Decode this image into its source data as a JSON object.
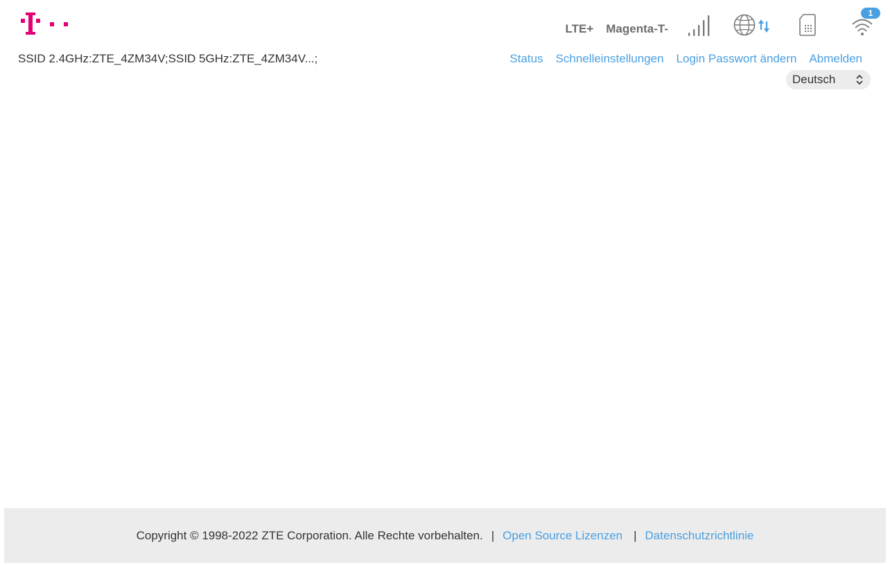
{
  "brand": {
    "logo_icon": "telekom-t-logo-icon",
    "color": "#e20074"
  },
  "status": {
    "network_type": "LTE+",
    "operator": "Magenta-T-",
    "signal_icon": "signal-strength-icon",
    "internet_icon": "globe-data-icon",
    "sim_icon": "sim-card-icon",
    "wifi_icon": "wifi-icon",
    "wifi_clients": "1"
  },
  "ssid_text": "SSID 2.4GHz:ZTE_4ZM34V;SSID 5GHz:ZTE_4ZM34V...;",
  "nav": {
    "items": [
      {
        "label": "Status"
      },
      {
        "label": "Schnelleinstellungen"
      },
      {
        "label": "Login Passwort ändern"
      },
      {
        "label": "Abmelden"
      }
    ]
  },
  "language": {
    "selected": "Deutsch"
  },
  "footer": {
    "copyright": "Copyright © 1998-2022 ZTE Corporation. Alle Rechte vorbehalten.",
    "sep1": "|",
    "open_source_label": "Open Source Lizenzen",
    "sep2": "|",
    "privacy_label": "Datenschutzrichtlinie"
  },
  "colors": {
    "accent": "#4a9fe0",
    "text": "#333333",
    "status_text": "#6b6b6b",
    "footer_bg": "#ececec"
  }
}
